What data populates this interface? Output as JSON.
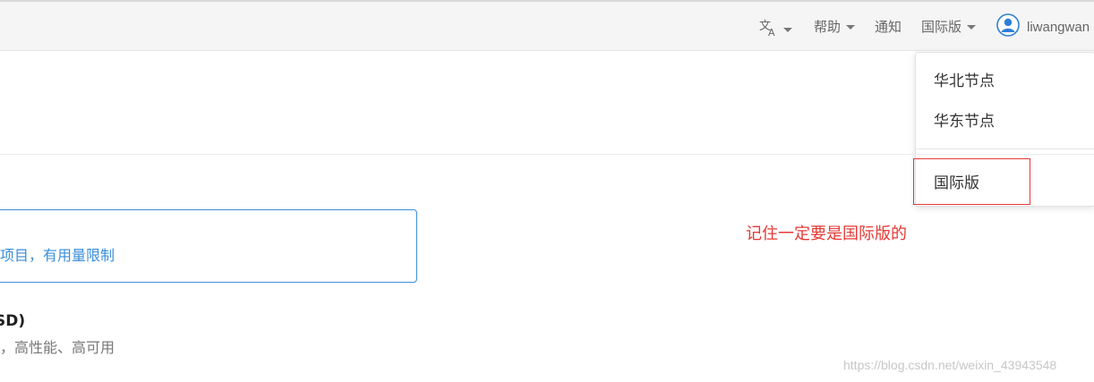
{
  "navbar": {
    "language_icon": "translate-icon",
    "help_label": "帮助",
    "notice_label": "通知",
    "edition_label": "国际版",
    "user_icon": "user-avatar-icon",
    "username": "liwangwan"
  },
  "dropdown": {
    "items": [
      {
        "label": "华北节点"
      },
      {
        "label": "华东节点"
      },
      {
        "label": "国际版"
      }
    ]
  },
  "annotation": {
    "text": "记住一定要是国际版的"
  },
  "main": {
    "notice_text": "项目，有用量限制",
    "product_title": "SD)",
    "product_desc": "，高性能、高可用"
  },
  "watermark": {
    "text": "https://blog.csdn.net/weixin_43943548"
  },
  "colors": {
    "accent_blue": "#3a8ed8",
    "annotation_red": "#e53935",
    "navbar_bg": "#f5f5f5"
  }
}
